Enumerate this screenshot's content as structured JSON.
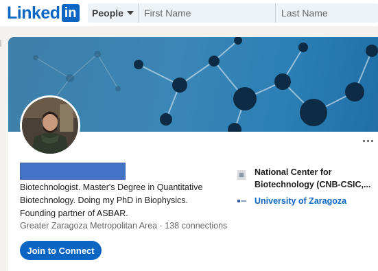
{
  "brand": {
    "name_text": "Linked",
    "name_box": "in",
    "color": "#0a66c2"
  },
  "search": {
    "filter_label": "People",
    "first_placeholder": "First Name",
    "last_placeholder": "Last Name"
  },
  "profile": {
    "headline": "Biotechnologist. Master's Degree in Quantitative Biotechnology. Doing my PhD in Biophysics. Founding partner of ASBAR.",
    "location": "Greater Zaragoza Metropolitan Area",
    "separator": "·",
    "connections": "138 connections",
    "join_label": "Join to Connect",
    "current_company": "National Center for Biotechnology (CNB-CSIC,...",
    "school": "University of Zaragoza"
  },
  "icons": {
    "more": "more-horizontal-icon",
    "dropdown": "chevron-down-icon"
  }
}
